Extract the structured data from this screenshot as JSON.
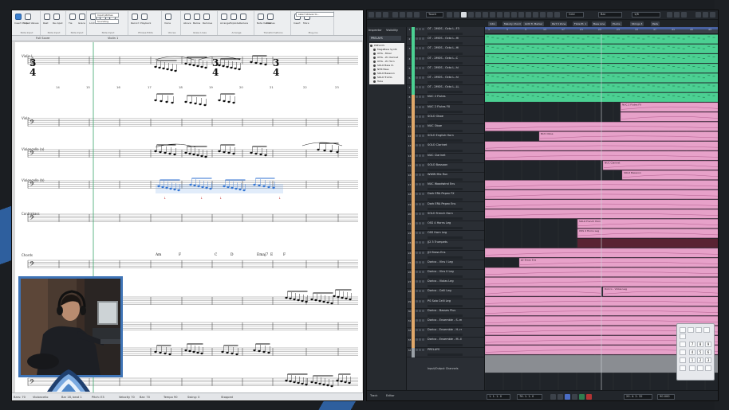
{
  "colors": {
    "accent_blue": "#3f74b6",
    "green_clip": "#4bd092",
    "pink_clip": "#e7a1c9",
    "cubase_bg": "#2c3036",
    "dorico_bg": "#ffffff"
  },
  "dorico": {
    "ribbon": {
      "groups": [
        {
          "caption": "Note Input",
          "labels": [
            "Insert Mode",
            "Input Values",
            "Triplets"
          ]
        },
        {
          "caption": "Note Input",
          "labels": [
            "Rest",
            "Re-input",
            "Chords"
          ]
        },
        {
          "caption": "Note Input",
          "labels": [
            "Tie",
            "Grace",
            "Slash"
          ]
        },
        {
          "caption": "Note Input",
          "labels": [
            "Lock",
            "Stem",
            "Beam"
          ]
        },
        {
          "caption": "Phrase Edits",
          "labels": [
            "Record",
            "Playback"
          ]
        },
        {
          "caption": "Voices",
          "labels": [
            "Voice",
            "Swap"
          ]
        },
        {
          "caption": "Glass Lines",
          "labels": [
            "Above",
            "Below",
            "Remove"
          ]
        },
        {
          "caption": "Arrange",
          "labels": [
            "Arrange",
            "Explode",
            "Reduce"
          ]
        },
        {
          "caption": "Transformations",
          "labels": [
            "Note Values",
            "Pitches"
          ]
        },
        {
          "caption": "Plug-ins",
          "labels": [
            "Insert",
            "More"
          ]
        }
      ],
      "input_field_1": "Input pitches",
      "input_field_2": "Sounding",
      "search_value": "select staves to..."
    },
    "tabs": [
      "Full Score",
      "Violin 1"
    ],
    "staff_labels": [
      "Violin I",
      "Viola",
      "Violoncello (a)",
      "Violoncello (b)",
      "Contrabass",
      "Chords",
      "NUC Clarinet"
    ],
    "time_signature": "3\n4",
    "bar_numbers": [
      "14",
      "15",
      "16",
      "17",
      "18",
      "19",
      "20",
      "21",
      "22",
      "23"
    ],
    "chord_symbols": [
      "Am",
      "F",
      "C",
      "D",
      "Emaj7",
      "E",
      "F"
    ],
    "status_items": [
      "Bars: 70",
      "Violoncello",
      "Bar 18, beat 1",
      "Pitch: E3",
      "Velocity 70",
      "Bar: 70",
      "Tempo 90",
      "Swing: 0",
      "Stopped"
    ]
  },
  "cubase": {
    "toolbar": {
      "mode": "Touch",
      "snap": "Grid",
      "quantize": "Bar",
      "length": "1/8"
    },
    "marker_tabs": [
      "Intro",
      "Melody Chord",
      "GOS Tr. Marker",
      "Part 3 Zone",
      "Flute Pt. 1",
      "Bass Line",
      "Plucks",
      "Strings 3",
      "Pads"
    ],
    "inspector": {
      "tab_inspector": "Inspector",
      "tab_visibility": "Visibility",
      "preset": "PRELAYS",
      "tree": [
        "PRELAYS",
        "MegaBass Synth",
        "OHG - Mixer",
        "OHG - W. Clarinet",
        "OHG - W. Horn",
        "SOLO Bass Cl.",
        "NHR Bass",
        "SOLO Bassoon",
        "SOLO Tromb.",
        "Tuba"
      ]
    },
    "tracks": [
      {
        "num": "1",
        "name": "OT - 2MOS - Octo L..F3",
        "color": "#4bd092"
      },
      {
        "num": "2",
        "name": "OT - 2MOS - Octo L..Hi",
        "color": "#4bd092"
      },
      {
        "num": "3",
        "name": "OT - 2MOS - Octo L..Hi",
        "color": "#4bd092"
      },
      {
        "num": "4",
        "name": "OT - 2MOS - Octo L..C",
        "color": "#4bd092"
      },
      {
        "num": "5",
        "name": "OT - 2MOS - Octo L..hi",
        "color": "#4bd092"
      },
      {
        "num": "6",
        "name": "OT - 2MOS - Octo L..hi",
        "color": "#4bd092"
      },
      {
        "num": "7",
        "name": "OT - 2MOS - Octo L..LL",
        "color": "#4bd092"
      },
      {
        "num": "8",
        "name": "NUC 2 Flutes",
        "color": "#e0a86a"
      },
      {
        "num": "9",
        "name": "NUC 2 Flutes FX",
        "color": "#e0a86a"
      },
      {
        "num": "10",
        "name": "SOLO Oboe",
        "color": "#e0a86a"
      },
      {
        "num": "11",
        "name": "NUC Oboe",
        "color": "#e0a86a"
      },
      {
        "num": "12",
        "name": "SOLO English Horn",
        "color": "#e0a86a"
      },
      {
        "num": "13",
        "name": "SOLO Clarinet",
        "color": "#e0a86a"
      },
      {
        "num": "14",
        "name": "NUC Clarinet",
        "color": "#e0a86a"
      },
      {
        "num": "15",
        "name": "SOLO Bassoon",
        "color": "#e0a86a"
      },
      {
        "num": "16",
        "name": "WWW Mix Run",
        "color": "#e0a86a"
      },
      {
        "num": "17",
        "name": "NUC Woodwind Ens",
        "color": "#e0a86a"
      },
      {
        "num": "18",
        "name": "Dark ERA Pepex FX",
        "color": "#e0a86a"
      },
      {
        "num": "19",
        "name": "Dark ERA Pepex Ens",
        "color": "#e0a86a"
      },
      {
        "num": "20",
        "name": "SOLO French Horn",
        "color": "#e0a86a"
      },
      {
        "num": "21",
        "name": "OSS 4 Horns Leg",
        "color": "#e0a86a"
      },
      {
        "num": "22",
        "name": "OSS Horn Leg",
        "color": "#e0a86a"
      },
      {
        "num": "23",
        "name": "JJ2 3 Trumpets",
        "color": "#e0a86a"
      },
      {
        "num": "24",
        "name": "JJ2 Brass Ens",
        "color": "#e0a86a"
      },
      {
        "num": "25",
        "name": "Dorico - Vlns I Leg",
        "color": "#e0a86a"
      },
      {
        "num": "26",
        "name": "Dorico - Vlns II Leg",
        "color": "#e0a86a"
      },
      {
        "num": "27",
        "name": "Dorico - Violas Leg",
        "color": "#e0a86a"
      },
      {
        "num": "28",
        "name": "Dorico - Celli Leg",
        "color": "#e0a86a"
      },
      {
        "num": "29",
        "name": "PS Solo Celli Leg",
        "color": "#e0a86a"
      },
      {
        "num": "30",
        "name": "Dorico - Basses Plus",
        "color": "#e0a86a"
      },
      {
        "num": "31",
        "name": "Dorico - Ensemble - S..m",
        "color": "#e0a86a"
      },
      {
        "num": "32",
        "name": "Dorico - Ensemble - H..rr",
        "color": "#e0a86a"
      },
      {
        "num": "33",
        "name": "Dorico - Ensemble - M..ll",
        "color": "#e0a86a"
      },
      {
        "num": "34",
        "name": "PRELAYS",
        "color": "#9aa0a6"
      }
    ],
    "bottom_label": "Input/Output Channels",
    "ruler": [
      "1",
      "5",
      "9",
      "13",
      "17",
      "21",
      "25",
      "29",
      "33",
      "37",
      "41",
      "45",
      "49"
    ],
    "clip_labels": [
      "NUC Oboe",
      "NUC 2 Flutes FX",
      "NUC Clarinet",
      "SOLO Bassoon",
      "SOLO French Horn",
      "OSS 4 Horns Leg",
      "JJ2 Brass Ens",
      "Dorico - Violas Leg"
    ],
    "transport": {
      "tab_track": "Track",
      "tab_editor": "Editor",
      "position": "1. 1. 1. 0",
      "locator": "76. 1. 1. 0",
      "time": "20. 4. 2. 32",
      "tempo": "90.000"
    }
  },
  "keypad": [
    "7",
    "8",
    "9",
    "4",
    "5",
    "6",
    "1",
    "2",
    "3"
  ]
}
